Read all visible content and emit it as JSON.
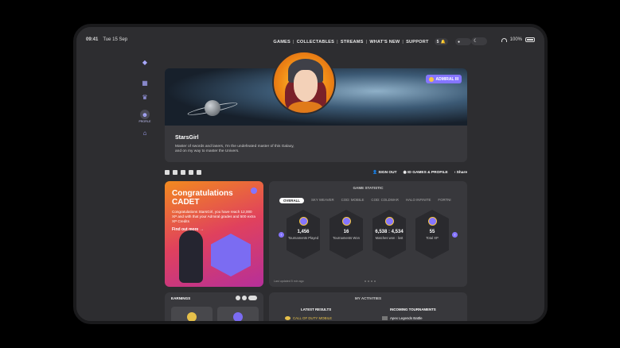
{
  "status": {
    "time": "09:41",
    "date": "Tue 15 Sep",
    "battery": "100%"
  },
  "nav": {
    "items": [
      "GAMES",
      "COLLECTABLES",
      "STREAMS",
      "WHAT'S NEW",
      "SUPPORT"
    ],
    "notif_count": "5"
  },
  "sidebar": {
    "profile_label": "PROFILE"
  },
  "profile": {
    "username": "StarsGirl",
    "bio": "Master of swords and lasers, I'm the undefeated master of this Galaxy, and on my way to master the Univers.",
    "rank_badge": "ADMIRAL III"
  },
  "actions": {
    "signout": "SIGN OUT",
    "games_profile": "ID GAMES & PROFILE",
    "share": "Share"
  },
  "congrats": {
    "title_line1": "Congratulations",
    "title_line2": "CADET",
    "desc": "Congratulations StarsGirl, you have reach 12,000 XP and with that your Admiral grades and 500 extra XP Credits",
    "more": "Find out more →"
  },
  "stats": {
    "title": "GAME STATISTIC",
    "tabs": [
      "OVERALL",
      "SKY WEAVER",
      "COD: MOBILE",
      "COD: COLDWAR",
      "HALO INFINITE",
      "FORTNI"
    ],
    "cards": [
      {
        "value": "1,456",
        "label": "Tournaments Played"
      },
      {
        "value": "16",
        "label": "Tournaments Won"
      },
      {
        "value": "6,538 : 4,534",
        "label": "Matches won : lost"
      },
      {
        "value": "55",
        "label": "Total XP"
      }
    ],
    "updated": "Last updated 5 min ago"
  },
  "earnings": {
    "title": "EARNINGS"
  },
  "activities": {
    "title": "MY ACTIVITIES",
    "latest_results": "LATEST RESULTS",
    "incoming": "INCOMING TOURNAMENTS",
    "latest_item": "CALL OF DUTY MOBILE",
    "incoming_item": "Apex Legends Battle"
  },
  "colors": {
    "accent": "#8575ff",
    "panel": "#38383c",
    "gold": "#f5c542"
  }
}
